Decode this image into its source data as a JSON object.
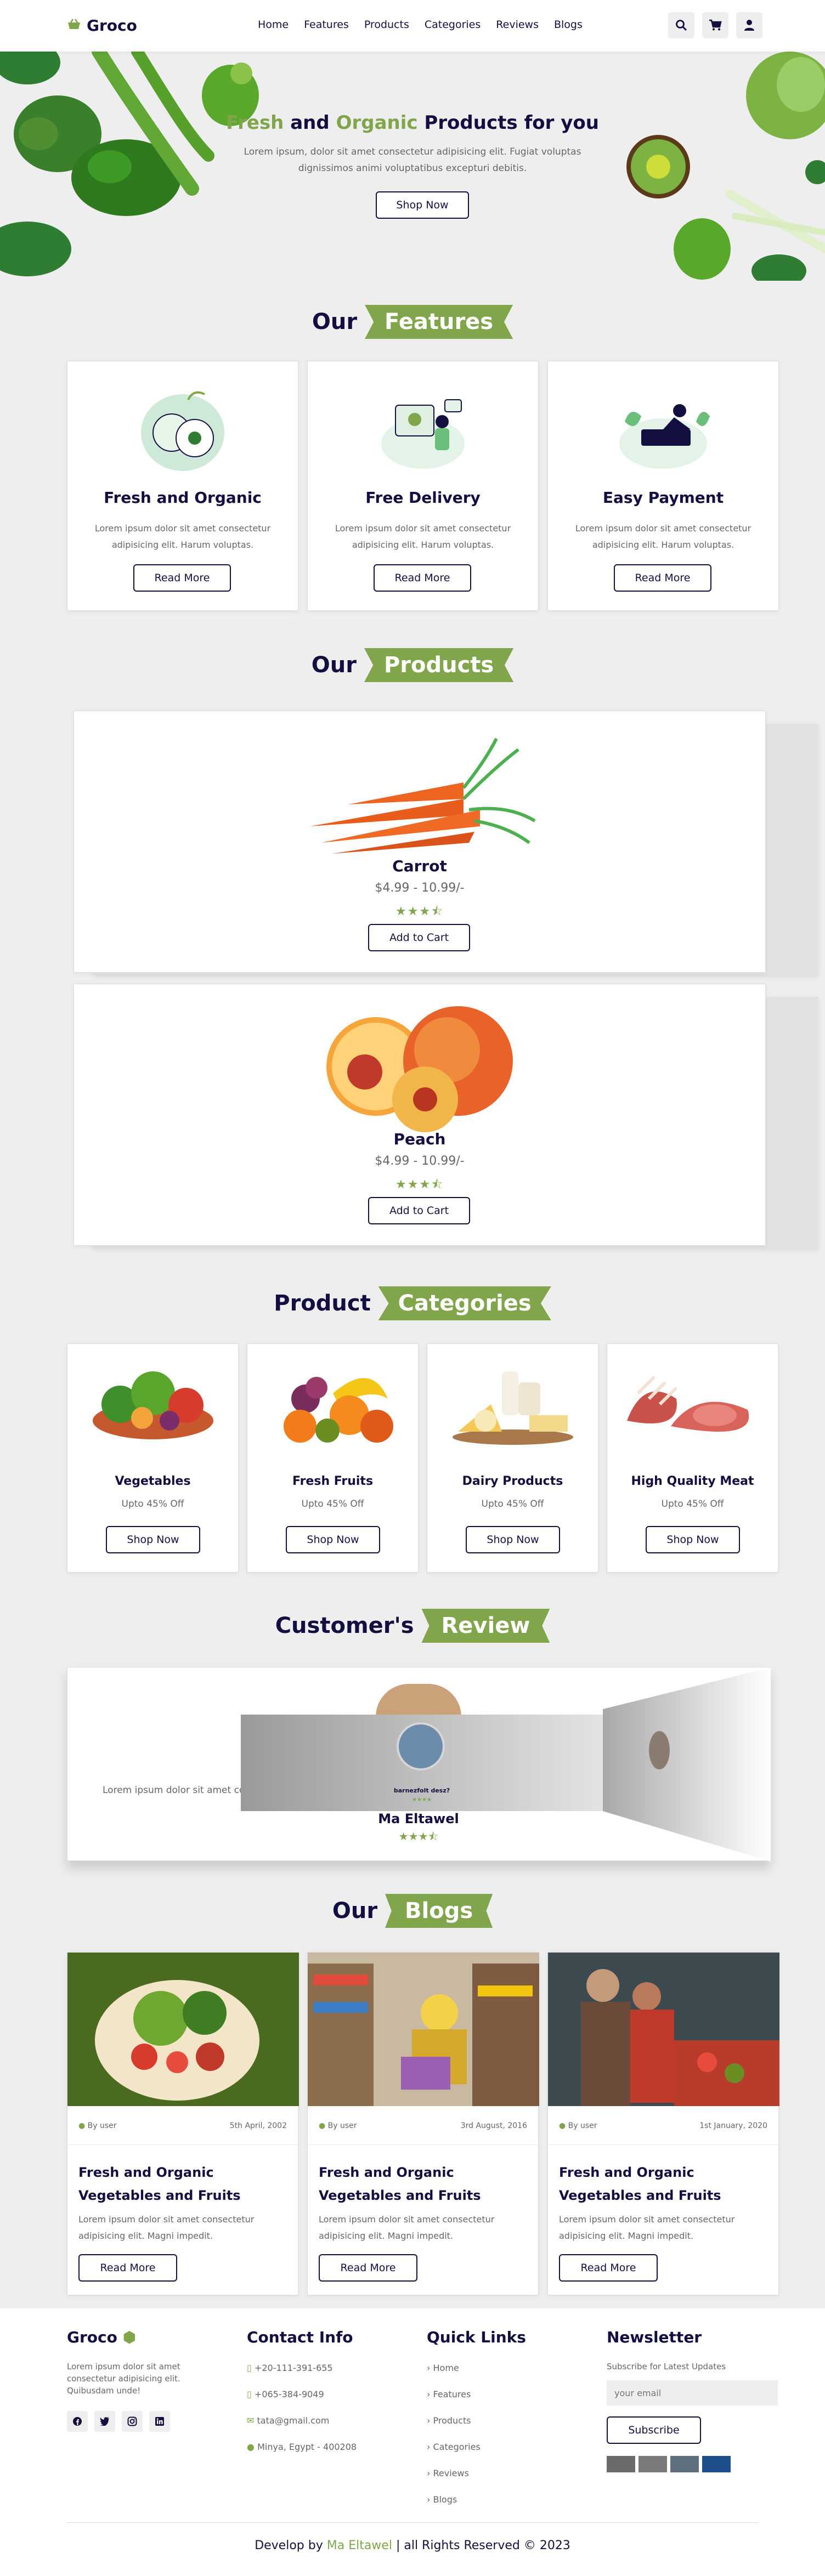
{
  "header": {
    "logo": "Groco",
    "nav": [
      "Home",
      "Features",
      "Products",
      "Categories",
      "Reviews",
      "Blogs"
    ],
    "icons": [
      "search-icon",
      "cart-icon",
      "user-icon"
    ]
  },
  "hero": {
    "title_fresh": "Fresh",
    "title_and": " and ",
    "title_organic": "Organic",
    "title_rest": " Products for you",
    "text": "Lorem ipsum, dolor sit amet consectetur adipisicing elit. Fugiat voluptas dignissimos animi voluptatibus excepturi debitis.",
    "button": "Shop Now"
  },
  "features": {
    "title_plain": "Our",
    "title_tag": "Features",
    "items": [
      {
        "title": "Fresh and Organic",
        "text": "Lorem ipsum dolor sit amet consectetur adipisicing elit. Harum voluptas.",
        "button": "Read More"
      },
      {
        "title": "Free Delivery",
        "text": "Lorem ipsum dolor sit amet consectetur adipisicing elit. Harum voluptas.",
        "button": "Read More"
      },
      {
        "title": "Easy Payment",
        "text": "Lorem ipsum dolor sit amet consectetur adipisicing elit. Harum voluptas.",
        "button": "Read More"
      }
    ]
  },
  "products": {
    "title_plain": "Our",
    "title_tag": "Products",
    "items": [
      {
        "name": "Carrot",
        "price": "$4.99 - 10.99/-",
        "rating": "★★★⯪",
        "button": "Add to Cart"
      },
      {
        "name": "Peach",
        "price": "$4.99 - 10.99/-",
        "rating": "★★★⯪",
        "button": "Add to Cart"
      }
    ]
  },
  "categories": {
    "title_plain": "Product",
    "title_tag": "Categories",
    "items": [
      {
        "name": "Vegetables",
        "offer": "Upto 45% Off",
        "button": "Shop Now"
      },
      {
        "name": "Fresh Fruits",
        "offer": "Upto 45% Off",
        "button": "Shop Now"
      },
      {
        "name": "Dairy Products",
        "offer": "Upto 45% Off",
        "button": "Shop Now"
      },
      {
        "name": "High Quality Meat",
        "offer": "Upto 45% Off",
        "button": "Shop Now"
      }
    ]
  },
  "reviews": {
    "title_plain": "Customer's",
    "title_tag": "Review",
    "left_text": "Lorem ipsum dolor sit amet co",
    "name": "Ma Eltawel",
    "rating": "★★★⯪",
    "inner_name": "barnezfolt desz?",
    "inner_rating": "★★★★"
  },
  "blogs": {
    "title_plain": "Our",
    "title_tag": "Blogs",
    "items": [
      {
        "user": "By user",
        "date": "5th April, 2002",
        "title": "Fresh and Organic Vegetables and Fruits",
        "text": "Lorem ipsum dolor sit amet consectetur adipisicing elit. Magni impedit.",
        "button": "Read More"
      },
      {
        "user": "By user",
        "date": "3rd August, 2016",
        "title": "Fresh and Organic Vegetables and Fruits",
        "text": "Lorem ipsum dolor sit amet consectetur adipisicing elit. Magni impedit.",
        "button": "Read More"
      },
      {
        "user": "By user",
        "date": "1st January, 2020",
        "title": "Fresh and Organic Vegetables and Fruits",
        "text": "Lorem ipsum dolor sit amet consectetur adipisicing elit. Magni impedit.",
        "button": "Read More"
      }
    ]
  },
  "footer": {
    "brand": "Groco",
    "about": "Lorem ipsum dolor sit amet consectetur adipisicing elit. Quibusdam unde!",
    "contact_title": "Contact Info",
    "phone1": "+20-111-391-655",
    "phone2": "+065-384-9049",
    "email": "tata@gmail.com",
    "address": "Minya, Egypt - 400208",
    "links_title": "Quick Links",
    "links": [
      "Home",
      "Features",
      "Products",
      "Categories",
      "Reviews",
      "Blogs"
    ],
    "newsletter_title": "Newsletter",
    "newsletter_text": "Subscribe for Latest Updates",
    "email_placeholder": "your email",
    "subscribe": "Subscribe",
    "copy_prefix": "Develop by ",
    "copy_name": "Ma Eltawel",
    "copy_suffix": " | all Rights Reserved © 2023"
  },
  "colors": {
    "accent": "#81a54a",
    "dark": "#130f40",
    "bg": "#eeeeee"
  }
}
